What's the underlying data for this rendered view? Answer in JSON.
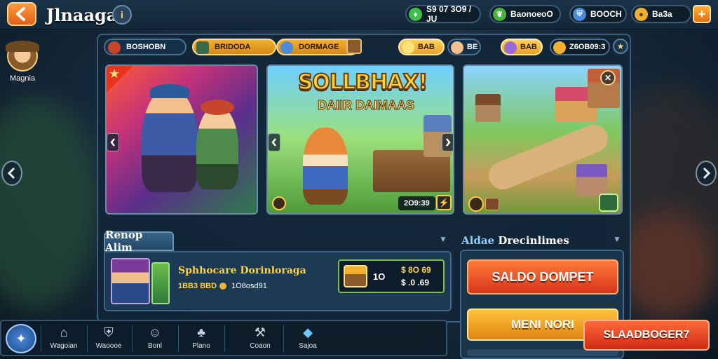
{
  "header": {
    "title": "Jlnaagai",
    "resources": [
      {
        "icon": "gem-icon",
        "value": "S9 07 3O9 / JU",
        "color": "#3fc04a"
      },
      {
        "icon": "leaf-icon",
        "value": "BaonoeoO",
        "color": "#4ab43a"
      },
      {
        "icon": "shield-icon",
        "value": "BOOCH",
        "color": "#4a8ad8"
      },
      {
        "icon": "coin-icon",
        "value": "Ba3a",
        "color": "#f2b030"
      }
    ]
  },
  "profile": {
    "name": "Magnia"
  },
  "tabs": [
    {
      "label": "BOSHOBN",
      "icon": "gem-icon"
    },
    {
      "label": "BRIDODA",
      "icon": "map-icon"
    },
    {
      "label": "DORMAGE",
      "icon": "globe-icon"
    }
  ],
  "currency_pills": [
    {
      "value": "BAB",
      "icon": "coin-icon"
    },
    {
      "value": "BE",
      "icon": "hero-icon"
    },
    {
      "value": "BAB",
      "icon": "crystal-icon"
    },
    {
      "value": "Z6OB09:3",
      "icon": "coin-icon"
    }
  ],
  "banners": {
    "feature": {
      "title": "SOLLBHAX!",
      "subtitle": "DAIIR DAIMAAS",
      "counter": "2O9:39"
    }
  },
  "rp": {
    "header": "Renop Alim",
    "title": "Sphhocare Dorinloraga",
    "sub_a": "1BB3",
    "sub_b": "BBD",
    "sub_c": "1O8osd91",
    "multiplier": "1O",
    "price_1": "$ 8O 69",
    "price_2": "$ .0 .69"
  },
  "right_panel": {
    "header_accent": "Aldae",
    "header_rest": "Drecinlimes",
    "btn_primary": "SALDO DOMPET",
    "btn_secondary": "MENI NORI",
    "btn_float": "SLAADBOGER7"
  },
  "nav": [
    {
      "label": "Wagoian",
      "icon": "home-icon"
    },
    {
      "label": "Waoooe",
      "icon": "shield-icon"
    },
    {
      "label": "Bonl",
      "icon": "face-icon"
    },
    {
      "label": "Plano",
      "icon": "tree-icon"
    },
    {
      "label": "Coaon",
      "icon": "tool-icon"
    },
    {
      "label": "Sajoa",
      "icon": "cube-icon"
    }
  ]
}
